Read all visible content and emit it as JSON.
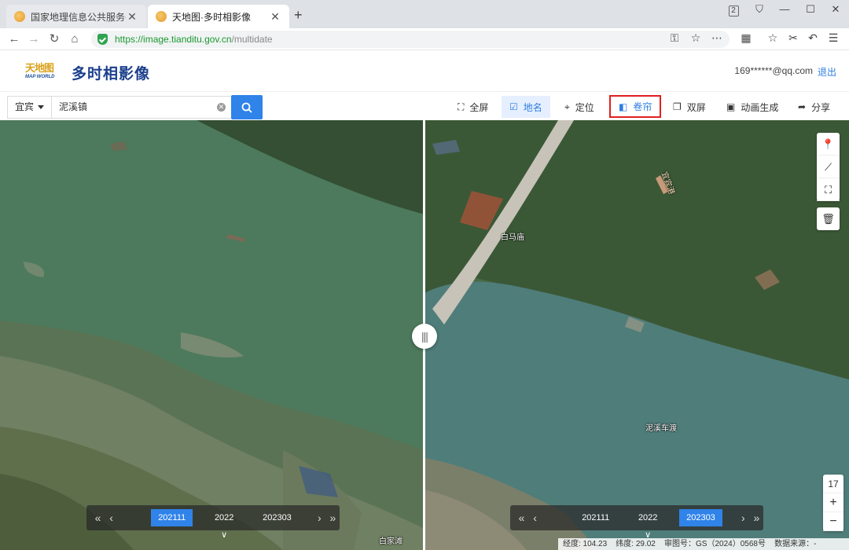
{
  "browser": {
    "tabs": [
      {
        "title": "国家地理信息公共服务平台 天"
      },
      {
        "title": "天地图·多时相影像"
      }
    ],
    "window_badge": "2",
    "url": {
      "protocol": "https://",
      "host": "image.tianditu.gov.cn",
      "path": "/multidate"
    }
  },
  "app": {
    "logo_cn": "天地图",
    "logo_en": "MAP WORLD",
    "title": "多时相影像",
    "user_email": "169******@qq.com",
    "logout_label": "退出"
  },
  "toolbar": {
    "region": "宜宾",
    "search_value": "泥溪镇",
    "tools": [
      {
        "label": "全屏",
        "icon": "fullscreen-icon"
      },
      {
        "label": "地名",
        "icon": "checkbox-icon",
        "state": "active"
      },
      {
        "label": "定位",
        "icon": "locate-icon"
      },
      {
        "label": "卷帘",
        "icon": "swipe-icon",
        "state": "highlighted"
      },
      {
        "label": "双屏",
        "icon": "dual-screen-icon"
      },
      {
        "label": "动画生成",
        "icon": "animation-icon"
      },
      {
        "label": "分享",
        "icon": "share-icon"
      }
    ]
  },
  "map": {
    "places": [
      "白马庙",
      "泥溪车渡",
      "白家滩",
      "宜宾港"
    ],
    "zoom_level": "17",
    "timeline_left": {
      "items": [
        "202111",
        "2022",
        "202303"
      ],
      "selected": "202111"
    },
    "timeline_right": {
      "items": [
        "202111",
        "2022",
        "202303"
      ],
      "selected": "202303"
    },
    "footer": {
      "lon": "经度: 104.23",
      "lat": "纬度: 29.02",
      "review": "审图号：GS（2024）0568号",
      "source": "数据来源：-"
    }
  },
  "colors": {
    "accent": "#2f83e9",
    "highlight_border": "#e02020",
    "title": "#1b3f8c"
  }
}
